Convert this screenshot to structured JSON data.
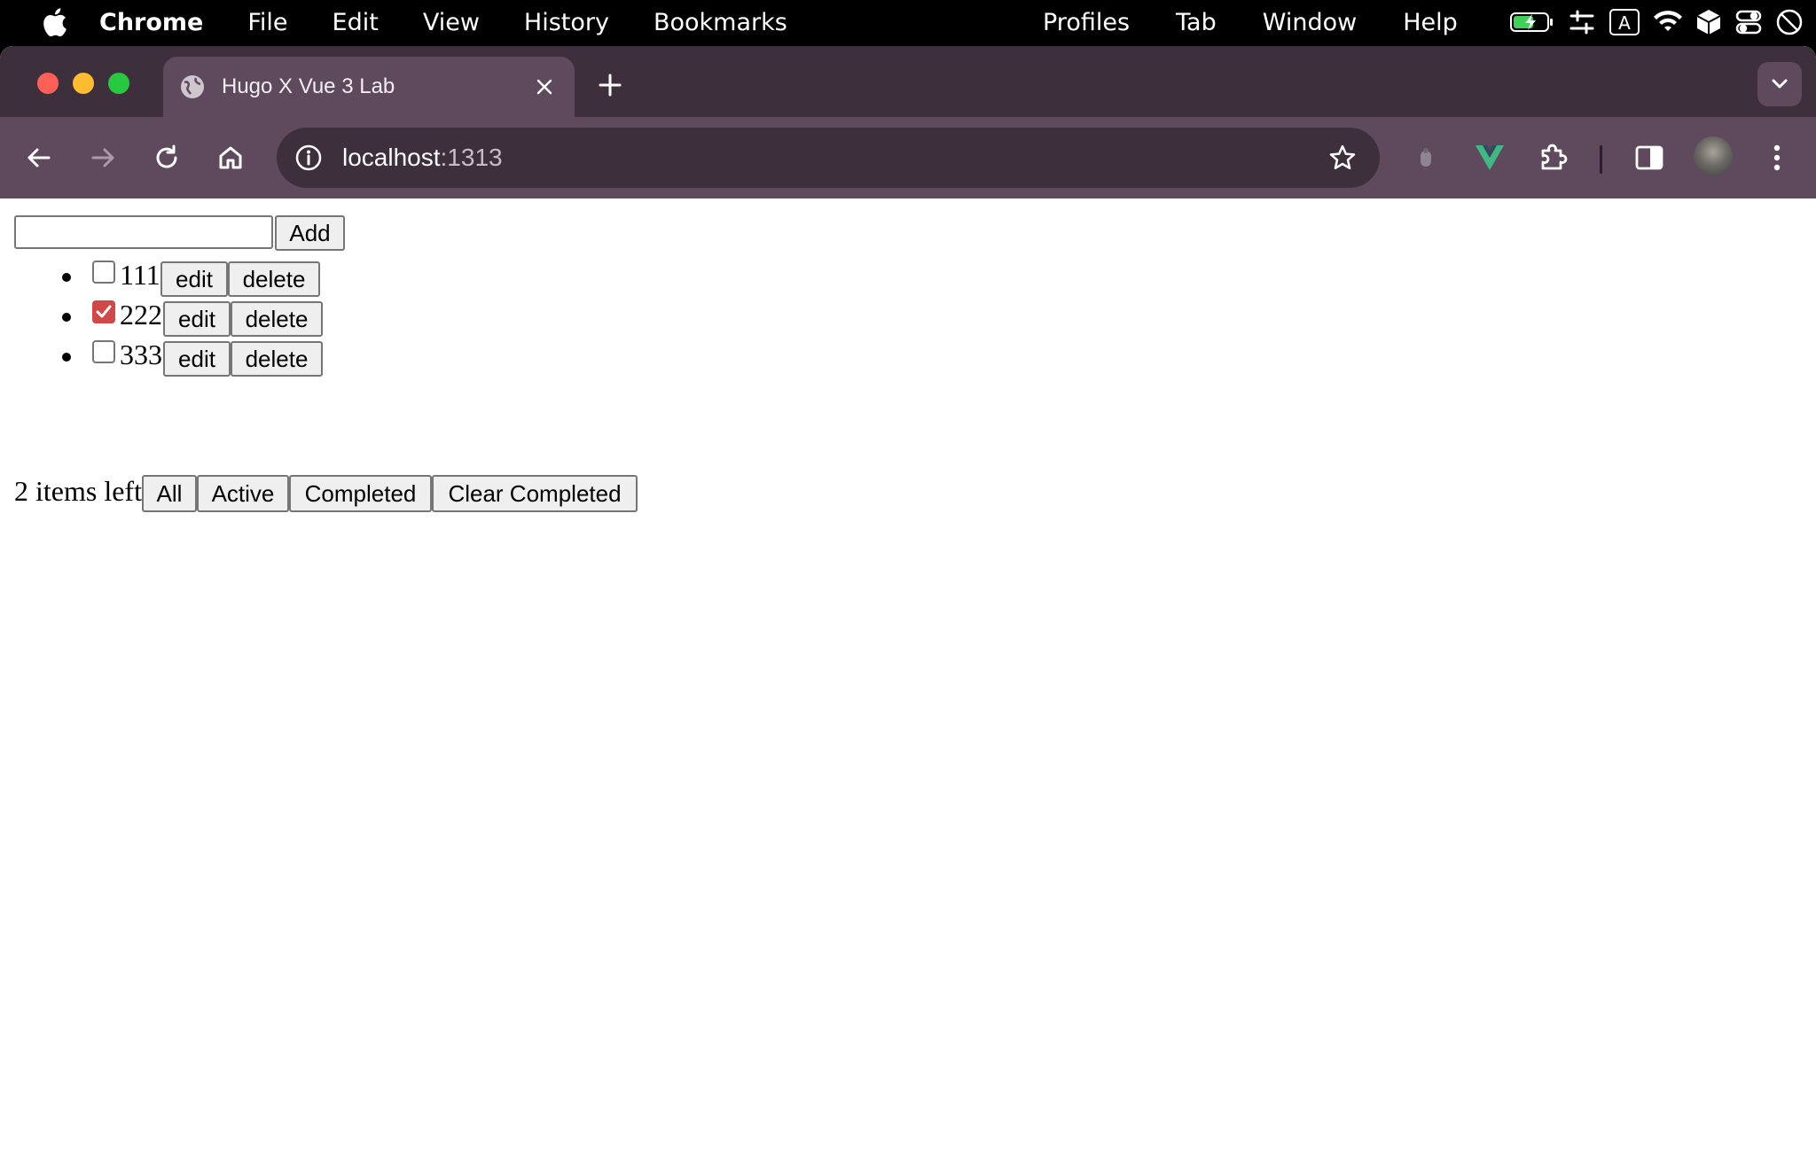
{
  "menubar": {
    "app_name": "Chrome",
    "items": [
      "File",
      "Edit",
      "View",
      "History",
      "Bookmarks"
    ],
    "right_items": [
      "Profiles",
      "Tab",
      "Window",
      "Help"
    ]
  },
  "browser": {
    "tab_title": "Hugo X Vue 3 Lab",
    "url_host": "localhost",
    "url_port": ":1313"
  },
  "app": {
    "input_value": "",
    "add_label": "Add",
    "todos": [
      {
        "text": "111",
        "completed": false
      },
      {
        "text": "222",
        "completed": true
      },
      {
        "text": "333",
        "completed": false
      }
    ],
    "edit_label": "edit",
    "delete_label": "delete",
    "items_left": "2 items left",
    "filters": [
      "All",
      "Active",
      "Completed"
    ],
    "clear_label": "Clear Completed"
  },
  "colors": {
    "tab_strip": "#3e2f3d",
    "toolbar": "#5e4a5c",
    "checkbox_checked": "#d04848",
    "vue_green": "#41b883"
  }
}
